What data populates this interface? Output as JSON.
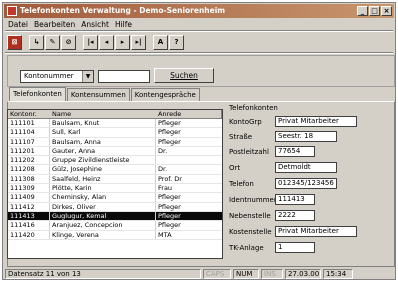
{
  "window": {
    "title": "Telefonkonten Verwaltung - Demo-Seniorenheim",
    "controls": [
      "_",
      "□",
      "×"
    ]
  },
  "menu": [
    "Datei",
    "Bearbeiten",
    "Ansicht",
    "Hilfe"
  ],
  "toolbar": {
    "icons": [
      "exit-icon",
      "new-icon",
      "edit-icon",
      "delete-icon",
      "first-icon",
      "prev-icon",
      "next-icon",
      "last-icon",
      "sign-icon",
      "help-icon"
    ],
    "glyphs": [
      "⊠",
      "↳",
      "✎",
      "⊘",
      "|◂",
      "◂",
      "▸",
      "▸|",
      "A",
      "?"
    ]
  },
  "search": {
    "combo_value": "Kontonummer",
    "field_value": "",
    "button_label": "Suchen"
  },
  "tabs": [
    "Telefonkonten",
    "Kontensummen",
    "Kontengespräche"
  ],
  "table": {
    "headers": [
      "Kontonr.",
      "Name",
      "Anrede"
    ],
    "rows": [
      [
        "111101",
        "Baulsam, Knut",
        "Pfleger"
      ],
      [
        "111104",
        "Sull, Karl",
        "Pfleger"
      ],
      [
        "111107",
        "Baulsam, Anna",
        "Pfleger"
      ],
      [
        "111201",
        "Gauter, Anna",
        "Dr."
      ],
      [
        "111202",
        "Gruppe Zivildienstleiste",
        ""
      ],
      [
        "111208",
        "Gülz, Josephine",
        "Dr."
      ],
      [
        "111308",
        "Saalfeld, Heinz",
        "Prof. Dr"
      ],
      [
        "111309",
        "Plötte, Karin",
        "Frau"
      ],
      [
        "111409",
        "Cheminsky, Alan",
        "Pfleger"
      ],
      [
        "111412",
        "Dirkes, Oliver",
        "Pfleger"
      ],
      [
        "111413",
        "Guglugur, Kemal",
        "Pfleger"
      ],
      [
        "111416",
        "Aranjuez, Concepcion",
        "Pfleger"
      ],
      [
        "111420",
        "Klinge, Verena",
        "MTA"
      ]
    ],
    "selected_index": 10
  },
  "detail": {
    "title": "Telefonkonten",
    "fields": [
      {
        "label": "KontoGrp",
        "value": "Privat Mitarbeiter"
      },
      {
        "label": "Straße",
        "value": "Seestr. 18"
      },
      {
        "label": "Postleitzahl",
        "value": "77654"
      },
      {
        "label": "Ort",
        "value": "Detmoldt"
      },
      {
        "label": "Telefon",
        "value": "012345/123456"
      },
      {
        "label": "Identnummer",
        "value": "111413"
      },
      {
        "label": "Nebenstelle",
        "value": "2222"
      },
      {
        "label": "Kostenstelle",
        "value": "Privat Mitarbeiter"
      },
      {
        "label": "TK-Anlage",
        "value": "1"
      }
    ]
  },
  "status": {
    "record": "Datensatz 11 von 13",
    "caps": "CAPS",
    "num": "NUM",
    "ins": "INS",
    "date": "27.03.00",
    "time": "15:34"
  }
}
